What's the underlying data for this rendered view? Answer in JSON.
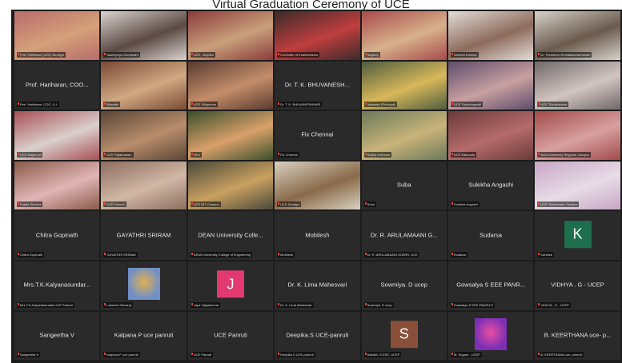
{
  "window": {
    "title": "Virtual Graduation Ceremony of UCE"
  },
  "colors": {
    "stage": "#1c1c1c",
    "tile_dark": "#2a2a2a",
    "mute_red": "#e0483e",
    "avatar_k": "#1f6f4e",
    "avatar_j": "#e23a70",
    "avatar_s": "#8a4f3a"
  },
  "tiles": [
    {
      "type": "video",
      "label": "Prof. Hariharan (UCE) Dindigul",
      "scene": "#b86c6a,#d4a07a"
    },
    {
      "type": "video",
      "label": "Sakthipriya Sundaram",
      "scene": "#d9d3cf,#5c4a44"
    },
    {
      "type": "video",
      "label": "UCE - Ariyalur",
      "scene": "#8b3b3b,#c9a07b"
    },
    {
      "type": "video",
      "label": "Controller of Examinations",
      "scene": "#3b2a2a,#c03e3e"
    },
    {
      "type": "video",
      "label": "Nagaraj",
      "scene": "#a84a4a,#d7b18c"
    },
    {
      "type": "video",
      "label": "Ashwini Kannan",
      "scene": "#e2ddd8,#8e6b5c"
    },
    {
      "type": "video",
      "label": "Dr. Poornima Venkatasubramanian",
      "scene": "#d6d2c9,#6b5a4e"
    },
    {
      "type": "name",
      "name": "Prof. Hariharan, COO...",
      "label": "Prof. Hariharan, COO, U.I."
    },
    {
      "type": "video",
      "label": "Bharathi",
      "scene": "#7a4a35,#d0a882"
    },
    {
      "type": "video",
      "label": "UCE Villupuram",
      "scene": "#5a3b30,#c48d6a"
    },
    {
      "type": "name",
      "name": "Dr. T. K. BHUVANESH...",
      "label": "Dr. T. K. BHUVANESHWARI"
    },
    {
      "type": "video",
      "label": "Jeyaselvi (Principal)",
      "scene": "#4f5c3f,#d8b85a"
    },
    {
      "type": "video",
      "label": "UCE Tiruchirappalli",
      "scene": "#5e4c6c,#c8a0a0"
    },
    {
      "type": "video",
      "label": "UCE Thirukkuvalai",
      "scene": "#70686a,#d2c5c0"
    },
    {
      "type": "video",
      "label": "UCE Nagercoil",
      "scene": "#a84f56,#d9d0cc"
    },
    {
      "type": "video",
      "label": "UCE Rajamadam",
      "scene": "#5b4636,#b88d6c"
    },
    {
      "type": "video",
      "label": "Devi",
      "scene": "#3b4f2c,#d9a06a"
    },
    {
      "type": "name",
      "name": "Fix Chennai",
      "label": "Fix Chennai"
    },
    {
      "type": "video",
      "label": "Radha Krishnan",
      "scene": "#6b7a5a,#c9b37a"
    },
    {
      "type": "video",
      "label": "UCE Kakinada",
      "scene": "#6b3a3a,#b56b6b"
    },
    {
      "type": "video",
      "label": "Anna University Regional Campus",
      "scene": "#a34a4a,#d8a0a0"
    },
    {
      "type": "video",
      "label": "Sujata Sharma",
      "scene": "#8a5a4a,#e0b5b5"
    },
    {
      "type": "video",
      "label": "UCE Panruti",
      "scene": "#8c6e5e,#d1b7a5"
    },
    {
      "type": "video",
      "label": "UCE BIT Campus",
      "scene": "#4a4a3a,#c9a060"
    },
    {
      "type": "video",
      "label": "UCE Dindigul",
      "scene": "#d8d0c0,#8a6a4a"
    },
    {
      "type": "name",
      "name": "Suba",
      "label": "Suba"
    },
    {
      "type": "name",
      "name": "Sulekha Angashi",
      "label": "Sulekha Angashi"
    },
    {
      "type": "video",
      "label": "UCE Tindivanam Campus",
      "scene": "#c7a6c6,#e7dce6"
    },
    {
      "type": "name",
      "name": "Chitra Gopinath",
      "label": "Chitra Gopinath"
    },
    {
      "type": "name",
      "name": "GAYATHRI SRIRAM",
      "label": "GAYATHRI SRIRAM"
    },
    {
      "type": "name",
      "name": "DEAN University Colle...",
      "label": "DEAN University College of Engineering"
    },
    {
      "type": "name",
      "name": "Mobilesh",
      "label": "Mobilesh"
    },
    {
      "type": "name",
      "name": "Dr. R. ARULAMAANI G...",
      "label": "Dr. R. ARULAMAANI GOWRI, UCE"
    },
    {
      "type": "name",
      "name": "Sudarsa",
      "label": "Sudarsa"
    },
    {
      "type": "avatar",
      "letter": "K",
      "label": "Karthick",
      "color": "#1f6f4e"
    },
    {
      "type": "name",
      "name": "Mrs.T.K.Kalyanasundar...",
      "label": "Mrs.T.K.Kalyanasundari UCE Panruti"
    },
    {
      "type": "thumb",
      "label": "Lakshmi Selvaraj",
      "scene": "#6e8fc9,#e0b050"
    },
    {
      "type": "avatar",
      "letter": "J",
      "label": "Jaya Vijayakumar",
      "color": "#e23a70"
    },
    {
      "type": "name",
      "name": "Dr. K. Lima Mahesvari",
      "label": "Dr. K. Lima Mahesvari"
    },
    {
      "type": "name",
      "name": "Sowmiya. D ucep",
      "label": "Sowmiya. D ucep"
    },
    {
      "type": "name",
      "name": "Gowsalya S EEE PANR...",
      "label": "Gowsalya S EEE PANRUTI"
    },
    {
      "type": "name",
      "name": "VIDHYA . G - UCEP",
      "label": "VIDHYA . G - UCEP"
    },
    {
      "type": "name",
      "name": "Sangeetha V",
      "label": "Sangeetha V"
    },
    {
      "type": "name",
      "name": "Kalpana P uce panruti",
      "label": "Kalpana P uce panruti"
    },
    {
      "type": "name",
      "name": "UCE Panruti",
      "label": "UCE Panruti"
    },
    {
      "type": "name",
      "name": "Deepika.S UCE-panruti",
      "label": "Deepika.S UCE-panruti"
    },
    {
      "type": "avatar",
      "letter": "S",
      "label": "Sathish, S EEE, UCEP",
      "color": "#8a4f3a"
    },
    {
      "type": "thumb",
      "label": "M. Sugam - UCEP",
      "scene": "#7b2fb5,#e94fa5"
    },
    {
      "type": "name",
      "name": "B. KEERTHANA uce- p...",
      "label": "B. KEERTHANA uce- panruti"
    }
  ]
}
